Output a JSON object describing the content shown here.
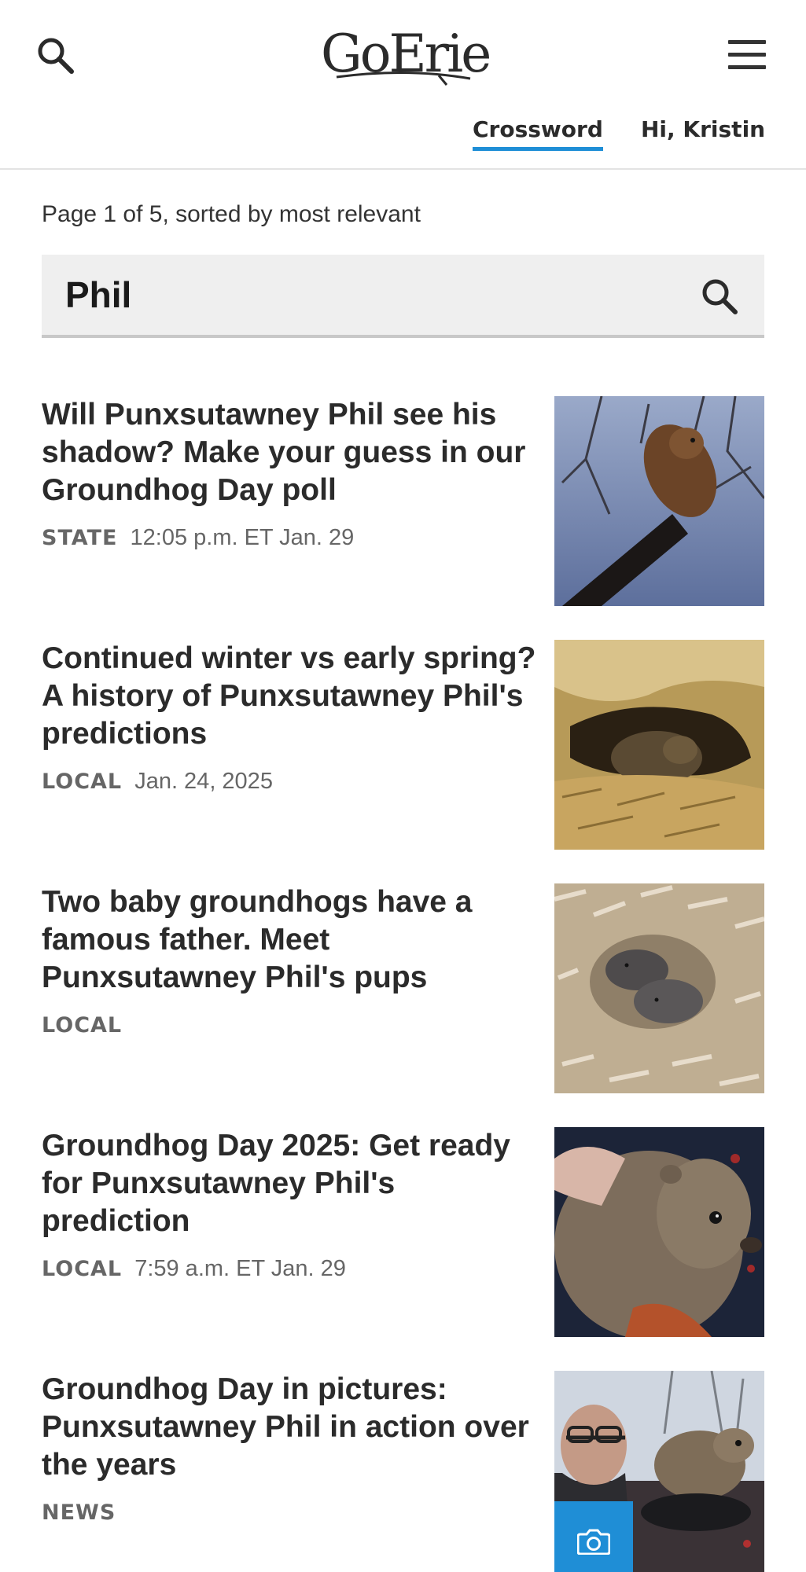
{
  "header": {
    "logo_text": "GoErie",
    "crossword_label": "Crossword",
    "greeting": "Hi, Kristin"
  },
  "search": {
    "page_info": "Page 1 of 5, sorted by most relevant",
    "query": "Phil"
  },
  "articles": [
    {
      "headline": "Will Punxsutawney Phil see his shadow? Make your guess in our Groundhog Day poll",
      "section": "STATE",
      "date": "12:05 p.m. ET Jan. 29",
      "image": "groundhog-held-up-against-sky"
    },
    {
      "headline": "Continued winter vs early spring? A history of Punxsutawney Phil's predictions",
      "section": "LOCAL",
      "date": "Jan. 24, 2025",
      "image": "groundhog-in-burrow"
    },
    {
      "headline": "Two baby groundhogs have a famous father. Meet Punxsutawney Phil's pups",
      "section": "LOCAL",
      "date": "",
      "image": "baby-groundhogs-in-wood-shavings"
    },
    {
      "headline": "Groundhog Day 2025: Get ready for Punxsutawney Phil's prediction",
      "section": "LOCAL",
      "date": "7:59 a.m. ET Jan. 29",
      "image": "groundhog-closeup"
    },
    {
      "headline": "Groundhog Day in pictures: Punxsutawney Phil in action over the years",
      "section": "NEWS",
      "date": "",
      "image": "man-with-groundhog",
      "badge": "camera-icon"
    }
  ],
  "colors": {
    "accent": "#1f8ed6",
    "text": "#2b2b2b",
    "meta": "#666666",
    "search_bg": "#efefef"
  }
}
